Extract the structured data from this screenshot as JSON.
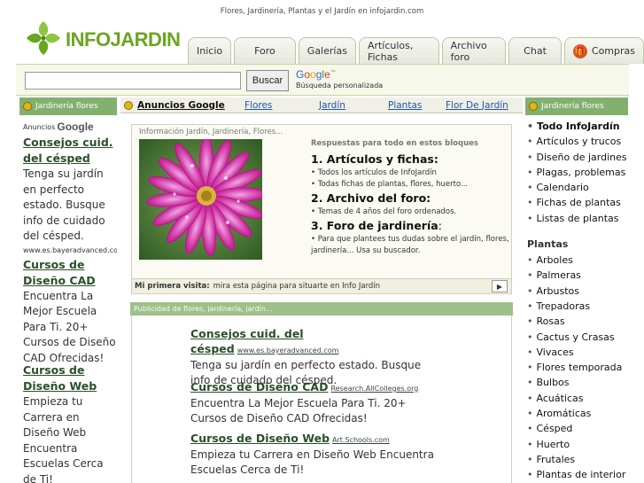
{
  "tagline": "Flores, Jardinería, Plantas y el Jardín en infojardin.com",
  "logo": {
    "text": "INFOJARDIN",
    "icon": "leaf-cross-logo",
    "color": "#6aa51f"
  },
  "tabs": [
    "Inicio",
    "Foro",
    "Galerías",
    "Artículos, Fichas",
    "Archivo foro",
    "Chat",
    "Compras"
  ],
  "search": {
    "value": "",
    "button": "Buscar",
    "google": "Google",
    "subtitle": "Búsqueda personalizada"
  },
  "left_bar": "Jardinería flores",
  "right_bar": "Jardinería flores",
  "nav": {
    "ads_label": "Anuncios Google",
    "links": [
      "Flores",
      "Jardín",
      "Plantas",
      "Flor De Jardín"
    ]
  },
  "left_ads": {
    "ads_by": "Anuncios",
    "google": "Google",
    "items": [
      {
        "title": "Consejos cuid. del césped",
        "desc": "Tenga su jardín en perfecto estado. Busque info de cuidado del césped.",
        "url": "www.es.bayeradvanced.com"
      },
      {
        "title": "Cursos de Diseño CAD",
        "desc": "Encuentra La Mejor Escuela Para Ti. 20+ Cursos de Diseño CAD Ofrecidas!",
        "url": ""
      },
      {
        "title": "Cursos de Diseño Web",
        "desc": "Empieza tu Carrera en Diseño Web Encuentra Escuelas Cerca de Ti!",
        "url": ""
      }
    ]
  },
  "info": {
    "header": "Información Jardín, Jardinería, Flores...",
    "heading": "Respuestas para todo en estos bloques",
    "sections": [
      {
        "title": "1. Artículos y fichas:",
        "items": [
          "• Todos los artículos de InfoJardín",
          "• Todas fichas de plantas, flores, huerto..."
        ]
      },
      {
        "title": "2. Archivo del foro:",
        "items": [
          "• Temas de 4 años del foro ordenados."
        ]
      },
      {
        "title": "3. Foro de jardinería",
        "suffix": ":",
        "items": [
          "• Para que plantees tus dudas sobre el jardín, flores, jardinería... Usa su buscador."
        ]
      }
    ],
    "first_visit_label": "Mi primera visita:",
    "first_visit_text": "mira esta página para situarte en Info Jardín"
  },
  "ads_bar": "Publicidad de flores, jardinería, jardín...",
  "center_ads": [
    {
      "title": "Consejos cuid. del césped",
      "url": "www.es.bayeradvanced.com",
      "desc": "Tenga su jardín en perfecto estado. Busque info de cuidado del césped."
    },
    {
      "title": "Cursos de Diseño CAD",
      "url": "Research.AllColleges.org",
      "desc": "Encuentra La Mejor Escuela Para Ti. 20+ Cursos de Diseño CAD Ofrecidas!"
    },
    {
      "title": "Cursos de Diseño Web",
      "url": "Art.Schools.com",
      "desc": "Empieza tu Carrera en Diseño Web Encuentra Escuelas Cerca de Ti!"
    }
  ],
  "right_col": {
    "top": [
      "Todo InfoJardín",
      "Artículos y trucos",
      "Diseño de jardines",
      "Plagas, problemas",
      "Calendario",
      "Fichas de plantas",
      "Listas de plantas"
    ],
    "plants_heading": "Plantas",
    "plants": [
      "Arboles",
      "Palmeras",
      "Arbustos",
      "Trepadoras",
      "Rosas",
      "Cactus y Crasas",
      "Vivaces",
      "Flores temporada",
      "Bulbos",
      "Acuáticas",
      "Aromáticas",
      "Césped",
      "Huerto",
      "Frutales",
      "Plantas de interior"
    ]
  }
}
